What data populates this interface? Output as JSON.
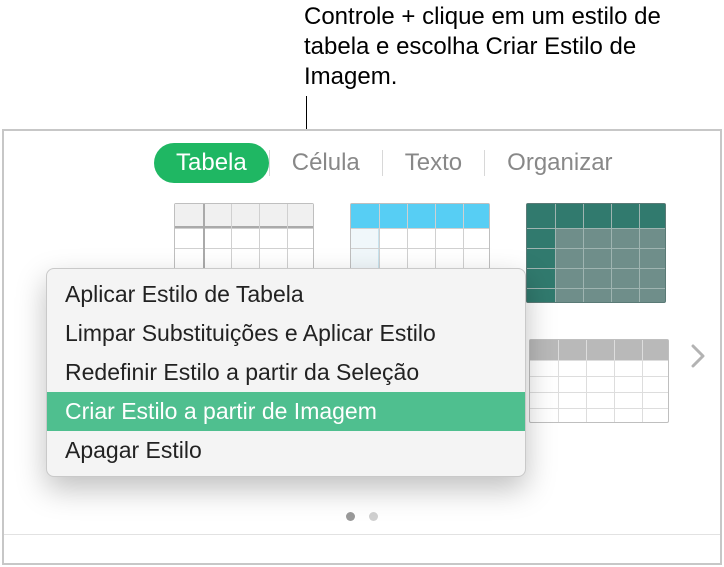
{
  "callout": "Controle + clique em um estilo de tabela e escolha Criar Estilo de Imagem.",
  "tabs": {
    "items": [
      {
        "label": "Tabela",
        "active": true
      },
      {
        "label": "Célula",
        "active": false
      },
      {
        "label": "Texto",
        "active": false
      },
      {
        "label": "Organizar",
        "active": false
      }
    ]
  },
  "context_menu": {
    "items": [
      {
        "label": "Aplicar Estilo de Tabela",
        "highlight": false
      },
      {
        "label": "Limpar Substituições e Aplicar Estilo",
        "highlight": false
      },
      {
        "label": "Redefinir Estilo a partir da Seleção",
        "highlight": false
      },
      {
        "label": "Criar Estilo a partir de Imagem",
        "highlight": true
      },
      {
        "label": "Apagar Estilo",
        "highlight": false
      }
    ]
  },
  "pagination": {
    "pages": 2,
    "current": 1
  }
}
